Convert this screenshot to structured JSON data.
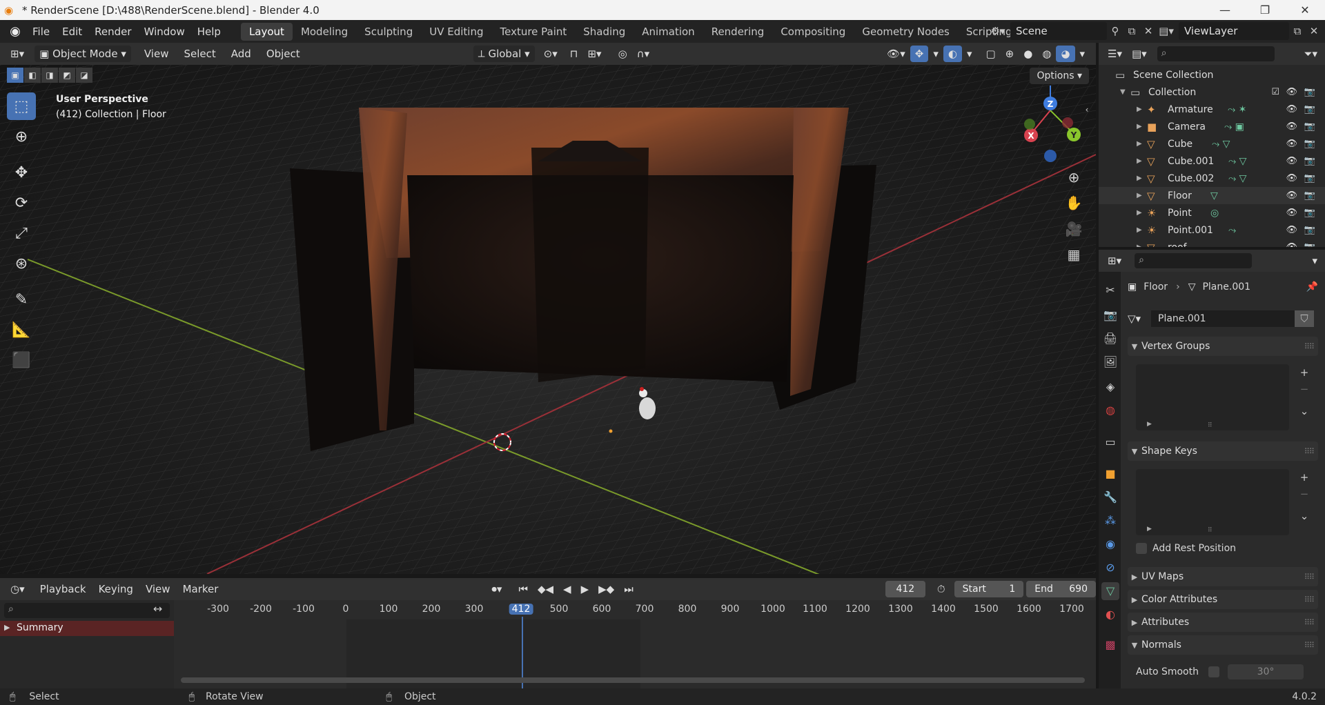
{
  "window": {
    "title": "* RenderScene [D:\\488\\RenderScene.blend] - Blender 4.0",
    "minimize": "—",
    "maximize": "❐",
    "close": "✕"
  },
  "menu": {
    "items": [
      "File",
      "Edit",
      "Render",
      "Window",
      "Help"
    ],
    "workspaces": [
      "Layout",
      "Modeling",
      "Sculpting",
      "UV Editing",
      "Texture Paint",
      "Shading",
      "Animation",
      "Rendering",
      "Compositing",
      "Geometry Nodes",
      "Scripting"
    ],
    "active_workspace": "Layout",
    "add_workspace": "+",
    "scene_name": "Scene",
    "view_layer": "ViewLayer"
  },
  "viewport_header": {
    "mode": "Object Mode",
    "menus": [
      "View",
      "Select",
      "Add",
      "Object"
    ],
    "orientation": "Global",
    "options": "Options"
  },
  "viewport": {
    "view_name": "User Perspective",
    "collection_info": "(412) Collection | Floor",
    "gizmo_axes": [
      "Z",
      "X",
      "Y"
    ]
  },
  "timeline": {
    "menus": [
      "Playback",
      "Keying",
      "View",
      "Marker"
    ],
    "current_frame": "412",
    "start_label": "Start",
    "start": "1",
    "end_label": "End",
    "end": "690",
    "ruler": [
      "-300",
      "-200",
      "-100",
      "0",
      "100",
      "200",
      "300",
      "412",
      "500",
      "600",
      "700",
      "800",
      "900",
      "1000",
      "1100",
      "1200",
      "1300",
      "1400",
      "1500",
      "1600",
      "1700"
    ],
    "summary": "Summary"
  },
  "statusbar": {
    "left": "Select",
    "middle": "Rotate View",
    "right": "Object",
    "version": "4.0.2"
  },
  "outliner": {
    "scene_collection": "Scene Collection",
    "collection": "Collection",
    "items": [
      {
        "name": "Armature",
        "icon": "armature-icon",
        "color": "#e8a25a"
      },
      {
        "name": "Camera",
        "icon": "camera-icon",
        "color": "#e8a25a"
      },
      {
        "name": "Cube",
        "icon": "mesh-icon",
        "color": "#e8a25a"
      },
      {
        "name": "Cube.001",
        "icon": "mesh-icon",
        "color": "#e8a25a"
      },
      {
        "name": "Cube.002",
        "icon": "mesh-icon",
        "color": "#e8a25a"
      },
      {
        "name": "Floor",
        "icon": "mesh-icon",
        "color": "#e8a25a"
      },
      {
        "name": "Point",
        "icon": "light-icon",
        "color": "#e8a25a"
      },
      {
        "name": "Point.001",
        "icon": "light-icon",
        "color": "#e8a25a"
      },
      {
        "name": "roof",
        "icon": "mesh-icon",
        "color": "#e8a25a"
      }
    ]
  },
  "properties": {
    "breadcrumb_object": "Floor",
    "breadcrumb_data": "Plane.001",
    "mesh_name": "Plane.001",
    "panels": {
      "vertex_groups": "Vertex Groups",
      "shape_keys": "Shape Keys",
      "add_rest_position": "Add Rest Position",
      "uv_maps": "UV Maps",
      "color_attributes": "Color Attributes",
      "attributes": "Attributes",
      "normals": "Normals",
      "auto_smooth": "Auto Smooth",
      "auto_smooth_angle": "30°"
    }
  },
  "colors": {
    "accent": "#4772b3",
    "x_axis": "#d8424f",
    "y_axis": "#8ac62c",
    "z_axis": "#3f7de0"
  }
}
